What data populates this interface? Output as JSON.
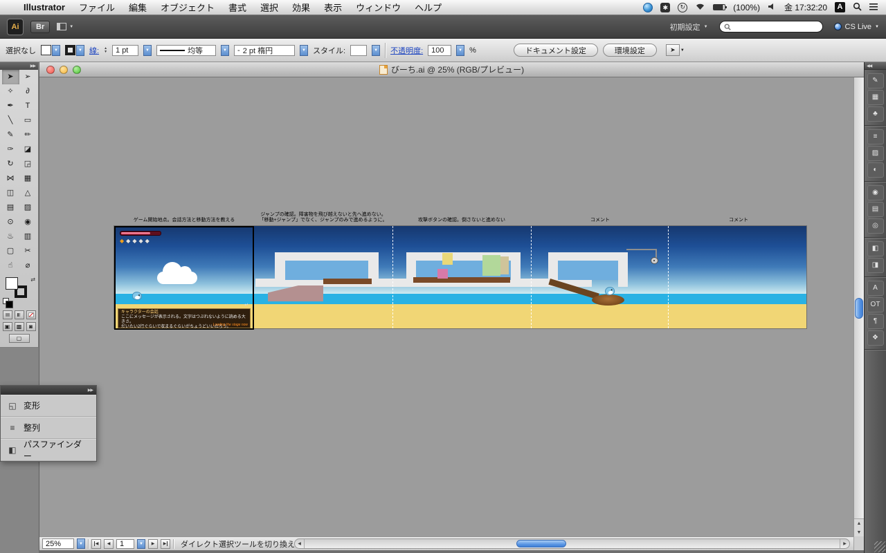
{
  "colors": {
    "accent_aqua": "#3f7fd6",
    "sky_top": "#16386f",
    "sky_bottom": "#cdeaf0",
    "water": "#29b2e4",
    "sand": "#f1d675",
    "platform": "#e9e9e9",
    "platform_window": "#6faede",
    "wood": "#7a4a28",
    "ramp": "#b49090",
    "dialog_bg": "#1e0f05",
    "health_bar": "#e05070",
    "hud_diamond": "#f0a01e"
  },
  "ui": {
    "dropdown": "▼",
    "up": "▲",
    "down": "▼",
    "left": "◀",
    "right": "▶",
    "double_left": "◀◀",
    "double_right": "▶▶",
    "swap": "⇄",
    "menu_arrow": "▶"
  },
  "menubar": {
    "apple_glyph": "",
    "app_name": "Illustrator",
    "menus": [
      "ファイル",
      "編集",
      "オブジェクト",
      "書式",
      "選択",
      "効果",
      "表示",
      "ウィンドウ",
      "ヘルプ"
    ],
    "status": {
      "ime_glyph": "✱",
      "sync_glyph": "↻",
      "battery_label": "(100%)",
      "clock": "金 17:32:20",
      "input_source": "A"
    }
  },
  "appbar": {
    "logo": "Ai",
    "bridge_label": "Br",
    "workspace_label": "初期設定",
    "cslive_label": "CS Live",
    "search_value": ""
  },
  "controlbar": {
    "selection_status": "選択なし",
    "stroke_label": "線:",
    "stroke_weight": "1 pt",
    "width_profile": "均等",
    "brush_prefix": "-",
    "brush_name": "2 pt 楕円",
    "style_label": "スタイル:",
    "opacity_label": "不透明度:",
    "opacity_value": "100",
    "opacity_unit": "%",
    "doc_setup_label": "ドキュメント設定",
    "preferences_label": "環境設定"
  },
  "tools": [
    {
      "name": "selection-tool",
      "glyph": "➤"
    },
    {
      "name": "direct-selection-tool",
      "glyph": "➢"
    },
    {
      "name": "magic-wand-tool",
      "glyph": "✧"
    },
    {
      "name": "lasso-tool",
      "glyph": "∂"
    },
    {
      "name": "pen-tool",
      "glyph": "✒"
    },
    {
      "name": "type-tool",
      "glyph": "T"
    },
    {
      "name": "line-segment-tool",
      "glyph": "╲"
    },
    {
      "name": "rectangle-tool",
      "glyph": "▭"
    },
    {
      "name": "paintbrush-tool",
      "glyph": "✎"
    },
    {
      "name": "pencil-tool",
      "glyph": "✏"
    },
    {
      "name": "blob-brush-tool",
      "glyph": "✑"
    },
    {
      "name": "eraser-tool",
      "glyph": "◪"
    },
    {
      "name": "rotate-tool",
      "glyph": "↻"
    },
    {
      "name": "scale-tool",
      "glyph": "◲"
    },
    {
      "name": "width-tool",
      "glyph": "⋈"
    },
    {
      "name": "free-transform-tool",
      "glyph": "▦"
    },
    {
      "name": "shape-builder-tool",
      "glyph": "◫"
    },
    {
      "name": "perspective-grid-tool",
      "glyph": "△"
    },
    {
      "name": "mesh-tool",
      "glyph": "▤"
    },
    {
      "name": "gradient-tool",
      "glyph": "▨"
    },
    {
      "name": "eyedropper-tool",
      "glyph": "⊙"
    },
    {
      "name": "blend-tool",
      "glyph": "◉"
    },
    {
      "name": "symbol-sprayer-tool",
      "glyph": "♨"
    },
    {
      "name": "column-graph-tool",
      "glyph": "▥"
    },
    {
      "name": "artboard-tool",
      "glyph": "▢"
    },
    {
      "name": "slice-tool",
      "glyph": "✂"
    },
    {
      "name": "hand-tool",
      "glyph": "☝"
    },
    {
      "name": "zoom-tool",
      "glyph": "⌀"
    }
  ],
  "toolbar_extras": {
    "draw_modes": [
      {
        "name": "draw-normal-mode",
        "glyph": "▣"
      },
      {
        "name": "draw-behind-mode",
        "glyph": "▩"
      },
      {
        "name": "draw-inside-mode",
        "glyph": "◙"
      }
    ],
    "screen_mode_glyph": "▢"
  },
  "float_panels": {
    "items": [
      {
        "name": "transform-panel-row",
        "glyph": "◱",
        "label": "変形"
      },
      {
        "name": "align-panel-row",
        "glyph": "≡",
        "label": "整列"
      },
      {
        "name": "pathfinder-panel-row",
        "glyph": "◧",
        "label": "パスファインダー"
      }
    ]
  },
  "dock": {
    "groups": [
      [
        {
          "name": "brushes-panel-icon",
          "glyph": "✎"
        },
        {
          "name": "swatches-panel-icon",
          "glyph": "▦"
        },
        {
          "name": "symbols-panel-icon",
          "glyph": "♣"
        }
      ],
      [
        {
          "name": "stroke-panel-icon",
          "glyph": "≡"
        },
        {
          "name": "gradient-panel-icon",
          "glyph": "▨"
        },
        {
          "name": "transparency-panel-icon",
          "glyph": "◐"
        }
      ],
      [
        {
          "name": "appearance-panel-icon",
          "glyph": "◉"
        },
        {
          "name": "layers-panel-icon",
          "glyph": "▤"
        },
        {
          "name": "navigator-panel-icon",
          "glyph": "◎"
        }
      ],
      [
        {
          "name": "color-panel-icon",
          "glyph": "◧"
        },
        {
          "name": "color-guide-panel-icon",
          "glyph": "◨"
        }
      ],
      [
        {
          "name": "character-panel-icon",
          "glyph": "A"
        },
        {
          "name": "opentype-panel-icon",
          "glyph": "OT"
        },
        {
          "name": "paragraph-panel-icon",
          "glyph": "¶"
        },
        {
          "name": "graphic-styles-panel-icon",
          "glyph": "❖"
        }
      ]
    ]
  },
  "document": {
    "title": "びーち.ai @ 25% (RGB/プレビュー)",
    "zoom": "25%",
    "artboard_number": "1",
    "status_hint": "ダイレクト選択ツールを切り換え"
  },
  "artwork": {
    "annotations": [
      "ゲーム開始地点。会話方法と移動方法を教える",
      "ジャンプの確認。障害物を飛び越えないと先へ進めない。\n「移動+ジャンプ」でなく、ジャンプのみで進めるように。",
      "攻撃ボタンの確認。倒さないと進めない",
      "コメント",
      "コメント"
    ],
    "hud": {
      "diamonds": [
        "◆",
        "◆",
        "◆",
        "◆",
        "◆"
      ]
    },
    "dialog": {
      "name_line": "キャラクターの会話",
      "lines": "ここにメッセージが表示される。文字はつぶれないように読める大きさ。\nだいたい2行ぐらいで収まるぐらいがちょうどいいだろう。",
      "loading": "Loading the stage now",
      "next_glyph": "↵"
    }
  }
}
